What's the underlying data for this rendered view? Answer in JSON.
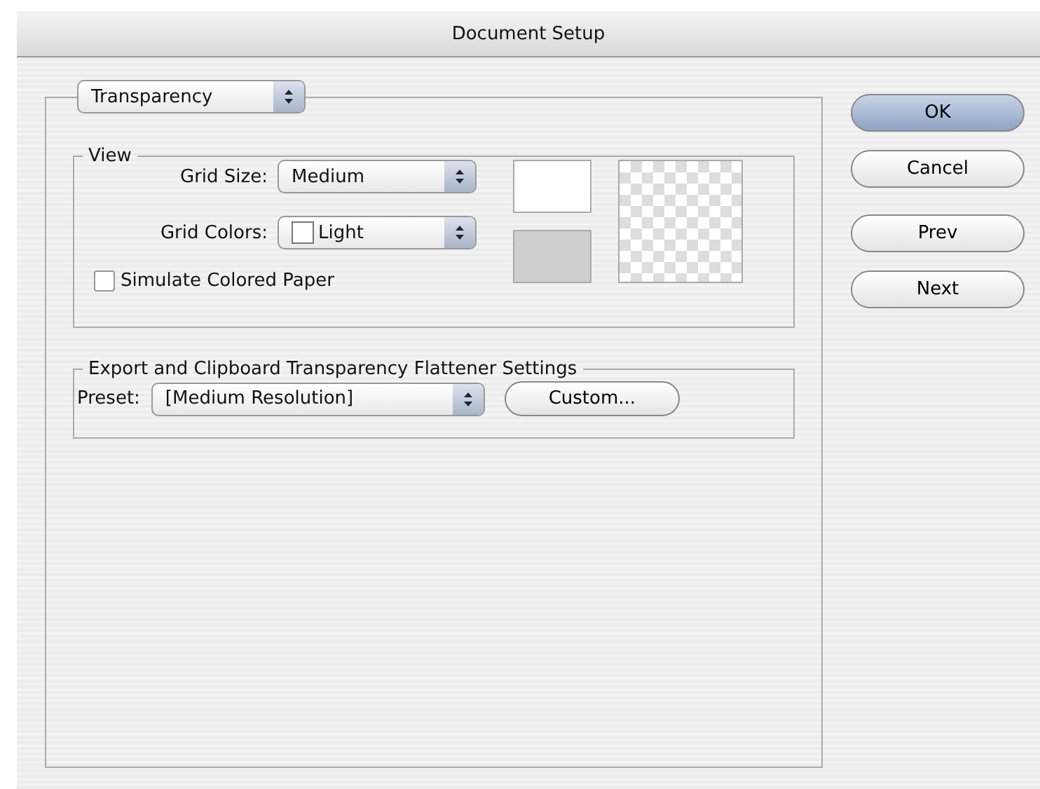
{
  "window": {
    "title": "Document Setup"
  },
  "section_popup": {
    "value": "Transparency"
  },
  "view": {
    "title": "View",
    "grid_size": {
      "label": "Grid Size:",
      "value": "Medium"
    },
    "grid_colors": {
      "label": "Grid Colors:",
      "value": "Light"
    },
    "simulate_colored_paper": {
      "label": "Simulate Colored Paper",
      "checked": false
    }
  },
  "flattener": {
    "title": "Export and Clipboard Transparency Flattener Settings",
    "preset": {
      "label": "Preset:",
      "value": "[Medium Resolution]"
    },
    "custom_button": "Custom..."
  },
  "buttons": [
    {
      "label": "OK",
      "default": true
    },
    {
      "label": "Cancel",
      "default": false
    },
    {
      "label": "Prev",
      "default": false
    },
    {
      "label": "Next",
      "default": false
    }
  ]
}
